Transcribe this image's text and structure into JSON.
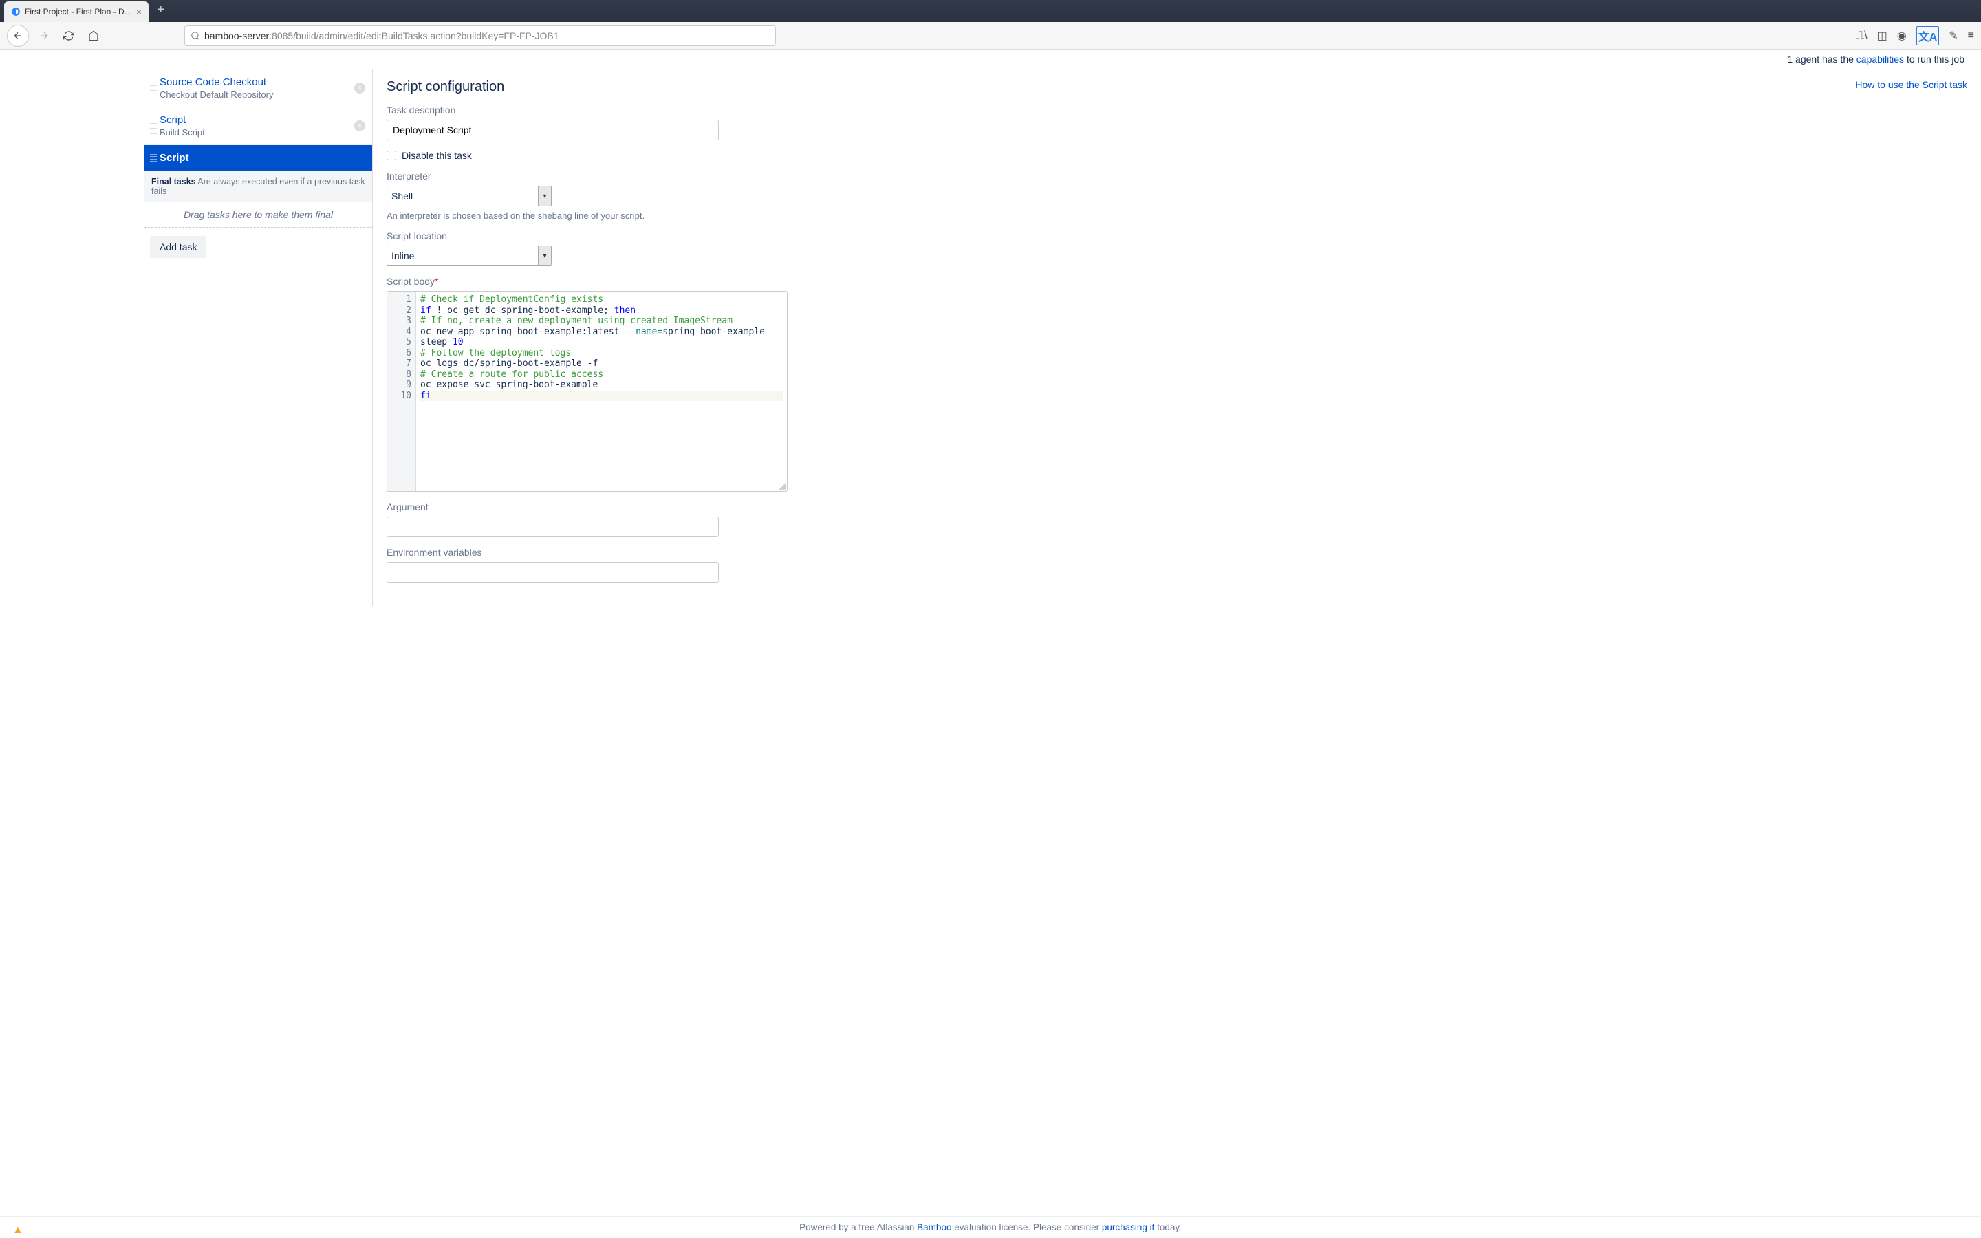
{
  "browser": {
    "tab_title": "First Project - First Plan - Defau",
    "url_host": "bamboo-server",
    "url_path": ":8085/build/admin/edit/editBuildTasks.action?buildKey=FP-FP-JOB1"
  },
  "agent_notice": {
    "prefix": "1 agent has the ",
    "link": "capabilities",
    "suffix": " to run this job"
  },
  "tasks": [
    {
      "title": "Source Code Checkout",
      "subtitle": "Checkout Default Repository"
    },
    {
      "title": "Script",
      "subtitle": "Build Script"
    },
    {
      "title": "Script",
      "subtitle": ""
    }
  ],
  "final_tasks": {
    "label": "Final tasks",
    "desc": "Are always executed even if a previous task fails",
    "drop_hint": "Drag tasks here to make them final"
  },
  "add_task_label": "Add task",
  "config": {
    "heading": "Script configuration",
    "help_link": "How to use the Script task",
    "fields": {
      "description_label": "Task description",
      "description_value": "Deployment Script",
      "disable_label": "Disable this task",
      "interpreter_label": "Interpreter",
      "interpreter_value": "Shell",
      "interpreter_hint": "An interpreter is chosen based on the shebang line of your script.",
      "location_label": "Script location",
      "location_value": "Inline",
      "body_label": "Script body",
      "argument_label": "Argument",
      "argument_value": "",
      "env_label": "Environment variables",
      "env_value": ""
    },
    "script_lines": [
      {
        "n": 1,
        "tokens": [
          {
            "t": "# Check if DeploymentConfig exists",
            "c": "c-comment"
          }
        ]
      },
      {
        "n": 2,
        "tokens": [
          {
            "t": "if",
            "c": "c-kw"
          },
          {
            "t": " ! oc get dc spring-boot-example; ",
            "c": ""
          },
          {
            "t": "then",
            "c": "c-kw"
          }
        ]
      },
      {
        "n": 3,
        "tokens": [
          {
            "t": "# If no, create a new deployment using created ImageStream",
            "c": "c-comment"
          }
        ]
      },
      {
        "n": 4,
        "tokens": [
          {
            "t": "oc new-app spring-boot-example:latest ",
            "c": ""
          },
          {
            "t": "--name=",
            "c": "c-flag"
          },
          {
            "t": "spring-boot-example",
            "c": ""
          }
        ]
      },
      {
        "n": 5,
        "tokens": [
          {
            "t": "sleep ",
            "c": ""
          },
          {
            "t": "10",
            "c": "c-num"
          }
        ]
      },
      {
        "n": 6,
        "tokens": [
          {
            "t": "# Follow the deployment logs",
            "c": "c-comment"
          }
        ]
      },
      {
        "n": 7,
        "tokens": [
          {
            "t": "oc logs dc/spring-boot-example -f",
            "c": ""
          }
        ]
      },
      {
        "n": 8,
        "tokens": [
          {
            "t": "# Create a route for public access",
            "c": "c-comment"
          }
        ]
      },
      {
        "n": 9,
        "tokens": [
          {
            "t": "oc expose svc spring-boot-example",
            "c": ""
          }
        ]
      },
      {
        "n": 10,
        "tokens": [
          {
            "t": "fi",
            "c": "c-kw"
          }
        ],
        "active": true
      }
    ]
  },
  "footer": {
    "prefix": "Powered by a free Atlassian ",
    "bamboo": "Bamboo",
    "mid": " evaluation license. Please consider ",
    "purchase": "purchasing it",
    "suffix": " today."
  }
}
